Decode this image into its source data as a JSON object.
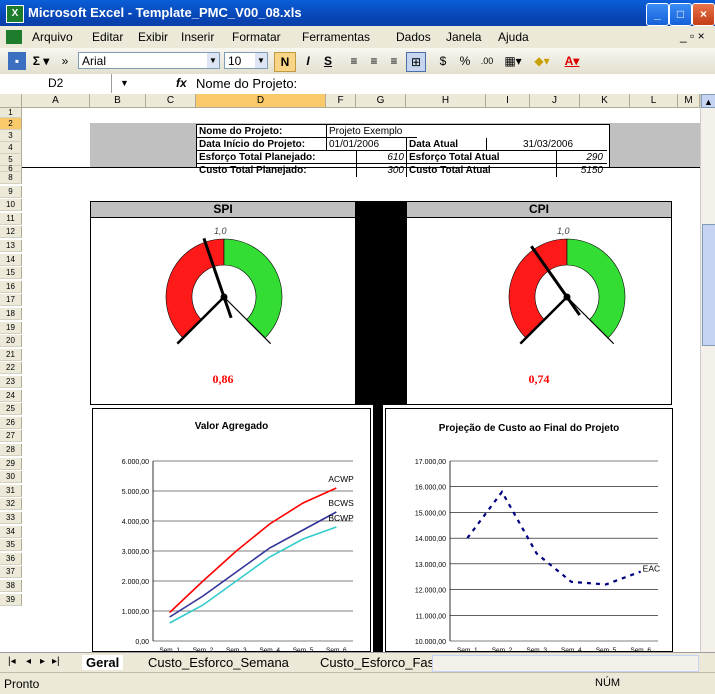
{
  "window": {
    "title": "Microsoft Excel - Template_PMC_V00_08.xls",
    "app_icon": "X"
  },
  "menu": [
    "Arquivo",
    "Editar",
    "Exibir",
    "Inserir",
    "Formatar",
    "Ferramentas",
    "Dados",
    "Janela",
    "Ajuda"
  ],
  "toolbar": {
    "font_name": "Arial",
    "font_size": "10",
    "bold": "N",
    "italic": "I",
    "underline": "S",
    "percent": "%"
  },
  "formula_bar": {
    "cell_ref": "D2",
    "fx": "fx",
    "content": "Nome do Projeto:"
  },
  "columns": [
    "A",
    "B",
    "C",
    "D",
    "F",
    "G",
    "H",
    "I",
    "J",
    "K",
    "L",
    "M"
  ],
  "rows": [
    "1",
    "2",
    "3",
    "4",
    "5",
    "6",
    "8",
    "9",
    "10",
    "11",
    "12",
    "13",
    "14",
    "15",
    "16",
    "17",
    "18",
    "19",
    "20",
    "21",
    "22",
    "23",
    "24",
    "25",
    "26",
    "27",
    "28",
    "29",
    "30",
    "31",
    "32",
    "33",
    "34",
    "35",
    "36",
    "37",
    "38",
    "39"
  ],
  "info_table": {
    "project_name_label": "Nome do Projeto:",
    "project_name_value": "Projeto Exemplo",
    "start_date_label": "Data Início do Projeto:",
    "start_date_value": "01/01/2006",
    "current_date_label": "Data Atual",
    "current_date_value": "31/03/2006",
    "planned_effort_label": "Esforço Total Planejado:",
    "planned_effort_value": "610",
    "actual_effort_label": "Esforço Total Atual",
    "actual_effort_value": "290",
    "planned_cost_label": "Custo Total Planejado:",
    "planned_cost_value": "300",
    "actual_cost_label": "Custo Total Atual",
    "actual_cost_value": "5150"
  },
  "gauges": {
    "spi": {
      "title": "SPI",
      "scale_label": "1,0",
      "value_text": "0,86",
      "value": 0.86
    },
    "cpi": {
      "title": "CPI",
      "scale_label": "1,0",
      "value_text": "0,74",
      "value": 0.74
    }
  },
  "colors": {
    "red_zone": "#ff1a1a",
    "green_zone": "#33dd33",
    "header_gray": "#c0c0c0",
    "value_red": "#ff0000"
  },
  "chart_data": [
    {
      "type": "line",
      "title": "Valor Agregado",
      "categories": [
        "Sem. 1",
        "Sem. 2",
        "Sem. 3",
        "Sem. 4",
        "Sem. 5",
        "Sem. 6"
      ],
      "yticks": [
        "0,00",
        "1.000,00",
        "2.000,00",
        "3.000,00",
        "4.000,00",
        "5.000,00",
        "6.000,00"
      ],
      "ylim": [
        0,
        6000
      ],
      "series": [
        {
          "name": "ACWP",
          "color": "#ff0000",
          "values": [
            950,
            2000,
            3000,
            3900,
            4600,
            5100
          ]
        },
        {
          "name": "BCWS",
          "color": "#333399",
          "values": [
            800,
            1500,
            2300,
            3100,
            3700,
            4300
          ]
        },
        {
          "name": "BCWP",
          "color": "#33cccc",
          "values": [
            600,
            1200,
            2000,
            2800,
            3400,
            3800
          ]
        }
      ]
    },
    {
      "type": "line",
      "title": "Projeção de Custo ao Final do Projeto",
      "categories": [
        "Sem. 1",
        "Sem. 2",
        "Sem. 3",
        "Sem. 4",
        "Sem. 5",
        "Sem. 6"
      ],
      "yticks": [
        "10.000,00",
        "11.000,00",
        "12.000,00",
        "13.000,00",
        "14.000,00",
        "15.000,00",
        "16.000,00",
        "17.000,00"
      ],
      "ylim": [
        10000,
        17000
      ],
      "series": [
        {
          "name": "EAC",
          "color": "#000080",
          "style": "dashed",
          "values": [
            14000,
            15800,
            13400,
            12300,
            12200,
            12700
          ]
        }
      ]
    }
  ],
  "sheet_tabs": [
    "Geral",
    "Custo_Esforco_Semana",
    "Custo_Esforco_Fas"
  ],
  "status": {
    "left": "Pronto",
    "num": "NÚM"
  }
}
